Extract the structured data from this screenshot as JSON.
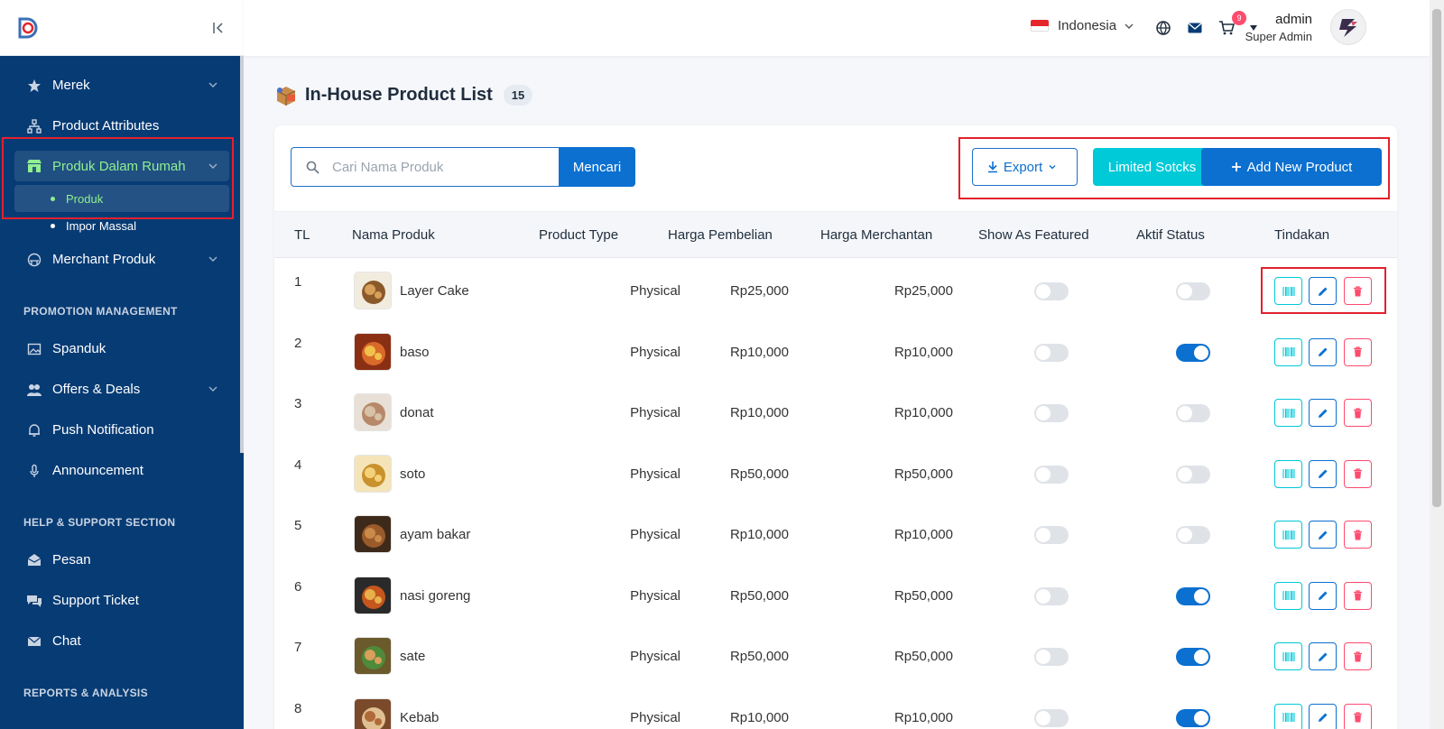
{
  "header": {
    "language": "Indonesia",
    "cart_badge": "9",
    "user_name": "admin",
    "user_role": "Super Admin"
  },
  "sidebar": {
    "items": [
      {
        "label": "Merek",
        "icon": "star-icon"
      },
      {
        "label": "Product Attributes",
        "icon": "hierarchy-icon"
      },
      {
        "label": "Produk Dalam Rumah",
        "icon": "store-icon"
      },
      {
        "label": "Merchant Produk",
        "icon": "store-alt-icon"
      }
    ],
    "sub_items": [
      "Produk",
      "Impor Massal"
    ],
    "promotion_title": "PROMOTION MANAGEMENT",
    "promotion_items": [
      {
        "label": "Spanduk",
        "icon": "image-icon"
      },
      {
        "label": "Offers & Deals",
        "icon": "people-icon"
      },
      {
        "label": "Push Notification",
        "icon": "bell-icon"
      },
      {
        "label": "Announcement",
        "icon": "mic-icon"
      }
    ],
    "help_title": "HELP & SUPPORT SECTION",
    "help_items": [
      {
        "label": "Pesan",
        "icon": "envelope-open-icon"
      },
      {
        "label": "Support Ticket",
        "icon": "chat-bubbles-icon"
      },
      {
        "label": "Chat",
        "icon": "mail-icon"
      }
    ],
    "reports_title": "REPORTS & ANALYSIS"
  },
  "page": {
    "title": "In-House Product List",
    "count": "15"
  },
  "toolbar": {
    "search_placeholder": "Cari Nama Produk",
    "search_button": "Mencari",
    "export": "Export",
    "limited": "Limited Sotcks",
    "add": "Add New Product"
  },
  "table": {
    "headers": [
      "TL",
      "Nama Produk",
      "Product Type",
      "Harga Pembelian",
      "Harga Merchantan",
      "Show As Featured",
      "Aktif Status",
      "Tindakan"
    ],
    "rows": [
      {
        "no": "1",
        "name": "Layer Cake",
        "type": "Physical",
        "buy": "Rp25,000",
        "sell": "Rp25,000",
        "featured": false,
        "active": false
      },
      {
        "no": "2",
        "name": "baso",
        "type": "Physical",
        "buy": "Rp10,000",
        "sell": "Rp10,000",
        "featured": false,
        "active": true
      },
      {
        "no": "3",
        "name": "donat",
        "type": "Physical",
        "buy": "Rp10,000",
        "sell": "Rp10,000",
        "featured": false,
        "active": false
      },
      {
        "no": "4",
        "name": "soto",
        "type": "Physical",
        "buy": "Rp50,000",
        "sell": "Rp50,000",
        "featured": false,
        "active": false
      },
      {
        "no": "5",
        "name": "ayam bakar",
        "type": "Physical",
        "buy": "Rp10,000",
        "sell": "Rp10,000",
        "featured": false,
        "active": false
      },
      {
        "no": "6",
        "name": "nasi goreng",
        "type": "Physical",
        "buy": "Rp50,000",
        "sell": "Rp50,000",
        "featured": false,
        "active": true
      },
      {
        "no": "7",
        "name": "sate",
        "type": "Physical",
        "buy": "Rp50,000",
        "sell": "Rp50,000",
        "featured": false,
        "active": true
      },
      {
        "no": "8",
        "name": "Kebab",
        "type": "Physical",
        "buy": "Rp10,000",
        "sell": "Rp10,000",
        "featured": false,
        "active": true
      }
    ]
  },
  "colors": {
    "sidebar": "#073b74",
    "accent": "#0b70d0",
    "cyan": "#00c9d8",
    "danger": "#ff4b6e",
    "active_nav": "#8ff08f",
    "highlight": "#e3212d"
  }
}
